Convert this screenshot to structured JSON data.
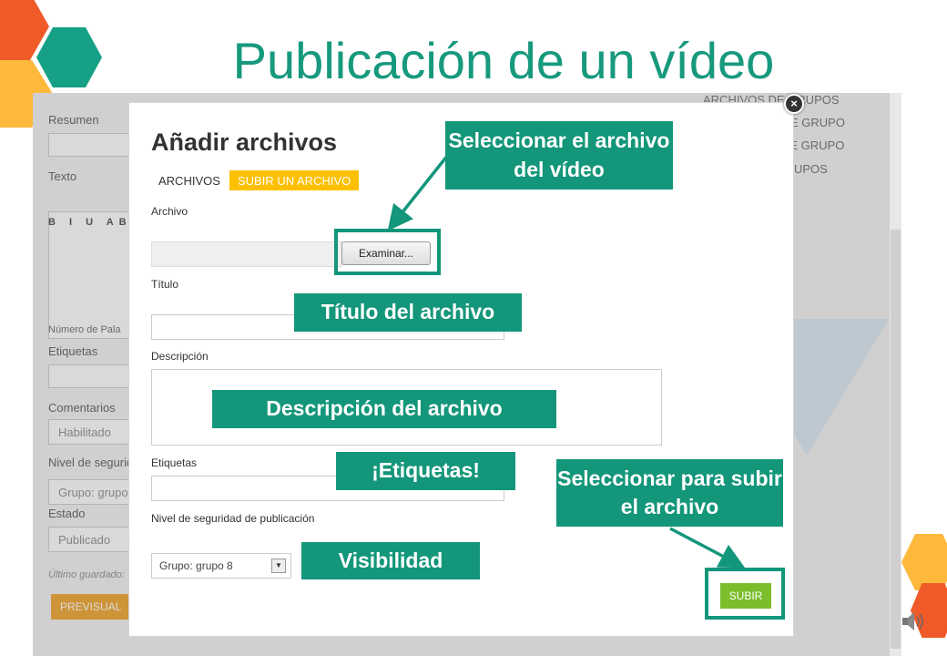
{
  "slide": {
    "title": "Publicación de un vídeo"
  },
  "background_form": {
    "resumen_label": "Resumen",
    "texto_label": "Texto",
    "toolbar_label": "B I U AB",
    "word_count": "Número de Pala",
    "etiquetas_label": "Etiquetas",
    "comentarios_label": "Comentarios",
    "comentarios_value": "Habilitado",
    "nivel_label": "Nivel de segurid",
    "nivel_value": "Grupo: grupo",
    "estado_label": "Estado",
    "estado_value": "Publicado",
    "last_saved": "Último guardado:",
    "preview_label": "PREVISUAL",
    "side_links": [
      "ARCHIVOS DE GRUPOS",
      "E GRUPO",
      "DE GRUPO",
      "UPOS"
    ]
  },
  "dialog": {
    "title": "Añadir archivos",
    "tabs": [
      {
        "label": "ARCHIVOS",
        "active": false
      },
      {
        "label": "SUBIR UN ARCHIVO",
        "active": true
      }
    ],
    "archivo_label": "Archivo",
    "browse_label": "Examinar...",
    "titulo_label": "Título",
    "descripcion_label": "Descripción",
    "etiquetas_label": "Etiquetas",
    "seguridad_label": "Nivel de seguridad de publicación",
    "seguridad_value": "Grupo: grupo 8",
    "submit_label": "SUBIR",
    "close_glyph": "×"
  },
  "callouts": {
    "select_file": "Seleccionar el archivo del vídeo",
    "file_title": "Título del archivo",
    "file_description": "Descripción del archivo",
    "tags": "¡Etiquetas!",
    "visibility": "Visibilidad",
    "upload": "Seleccionar para subir el archivo"
  },
  "colors": {
    "accent": "#13967a",
    "title": "#17997d",
    "tab_active": "#fcc000",
    "submit": "#7bbd2b",
    "hex_orange": "#f05a28",
    "hex_yellow": "#fdb93b",
    "hex_teal": "#16a085"
  },
  "icons": {
    "close": "close-icon",
    "speaker": "speaker-icon",
    "dropdown": "chevron-down-icon"
  }
}
